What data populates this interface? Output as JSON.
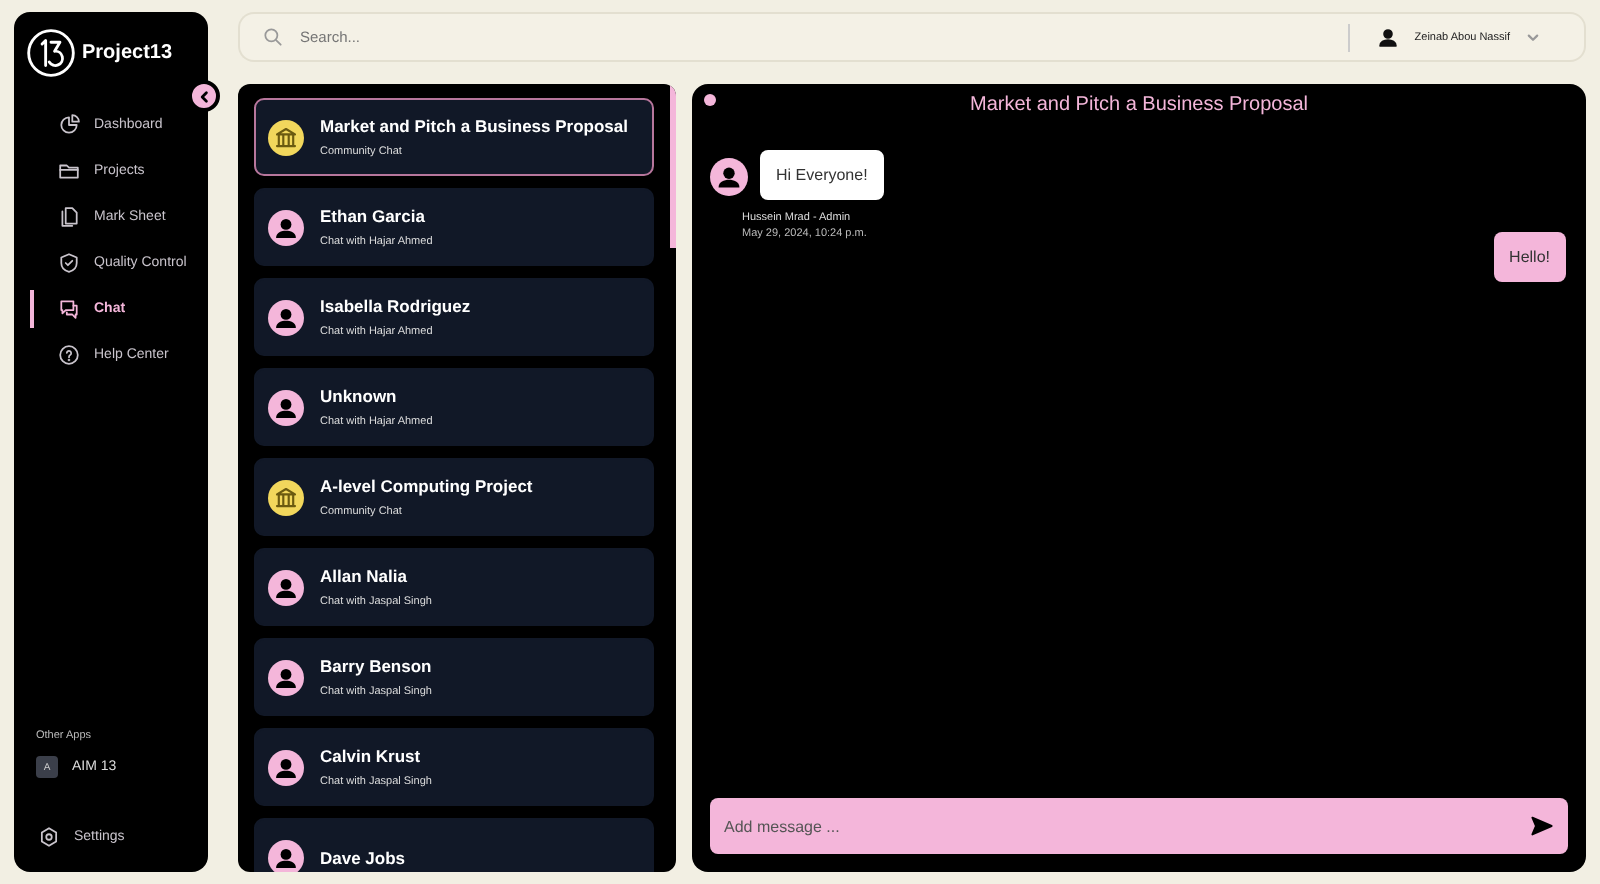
{
  "sidebar": {
    "brand": "Project13",
    "items": [
      {
        "label": "Dashboard",
        "selected": false
      },
      {
        "label": "Projects",
        "selected": false
      },
      {
        "label": "Mark Sheet",
        "selected": false
      },
      {
        "label": "Quality Control",
        "selected": false
      },
      {
        "label": "Chat",
        "selected": true
      },
      {
        "label": "Help Center",
        "selected": false
      }
    ],
    "other_apps_label": "Other Apps",
    "other_apps": [
      {
        "badge": "A",
        "label": "AIM 13"
      }
    ],
    "settings": "Settings"
  },
  "search": {
    "placeholder": "Search..."
  },
  "user": {
    "name": "Zeinab Abou Nassif"
  },
  "chats": [
    {
      "title": "Market and Pitch a Business Proposal",
      "subtitle": "Community Chat",
      "kind": "community",
      "selected": true
    },
    {
      "title": "Ethan Garcia",
      "subtitle": "Chat with Hajar Ahmed",
      "kind": "person",
      "selected": false
    },
    {
      "title": "Isabella Rodriguez",
      "subtitle": "Chat with Hajar Ahmed",
      "kind": "person",
      "selected": false
    },
    {
      "title": "Unknown",
      "subtitle": "Chat with Hajar Ahmed",
      "kind": "person",
      "selected": false
    },
    {
      "title": "A-level Computing Project",
      "subtitle": "Community Chat",
      "kind": "community",
      "selected": false
    },
    {
      "title": "Allan Nalia",
      "subtitle": "Chat with Jaspal Singh",
      "kind": "person",
      "selected": false
    },
    {
      "title": "Barry Benson",
      "subtitle": "Chat with Jaspal Singh",
      "kind": "person",
      "selected": false
    },
    {
      "title": "Calvin Krust",
      "subtitle": "Chat with Jaspal Singh",
      "kind": "person",
      "selected": false
    },
    {
      "title": "Dave Jobs",
      "kind": "person",
      "selected": false
    }
  ],
  "conversation": {
    "title": "Market and Pitch a Business Proposal",
    "messages": [
      {
        "kind": "incoming",
        "text": "Hi Everyone!",
        "author": "Hussein Mrad - Admin",
        "time": "May 29, 2024, 10:24 p.m."
      },
      {
        "kind": "outgoing",
        "text": "Hello!"
      }
    ],
    "composer": {
      "placeholder": "Add message ..."
    }
  }
}
